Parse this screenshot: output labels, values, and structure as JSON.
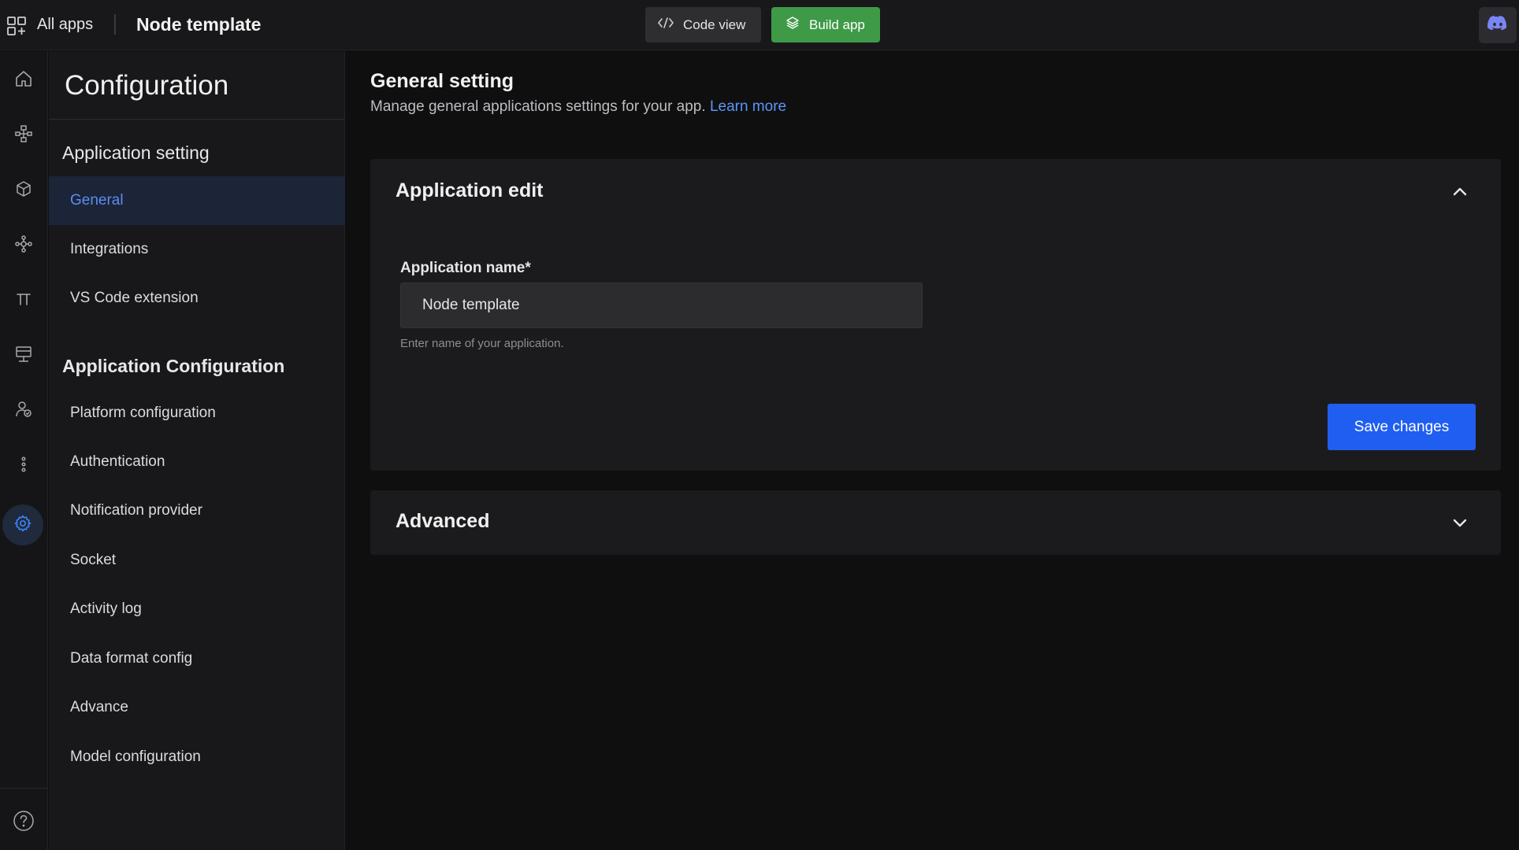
{
  "topbar": {
    "all_apps_label": "All apps",
    "app_title": "Node template",
    "code_view_label": "Code view",
    "build_app_label": "Build app",
    "build_color": "#3f9a47"
  },
  "rail": {
    "icons": [
      "home-icon",
      "workflow-icon",
      "models-icon",
      "graph-icon",
      "pi-icon",
      "deploy-icon",
      "users-icon",
      "more-vertical-icon",
      "settings-icon",
      "help-icon"
    ],
    "active": "settings-icon",
    "accent": "#3b82f6"
  },
  "config": {
    "title": "Configuration",
    "group1_title": "Application setting",
    "group1_items": [
      "General",
      "Integrations",
      "VS Code extension"
    ],
    "group2_title": "Application Configuration",
    "group2_items": [
      "Platform configuration",
      "Authentication",
      "Notification provider",
      "Socket",
      "Activity log",
      "Data format config",
      "Advance",
      "Model configuration"
    ],
    "active_item": "General"
  },
  "main": {
    "title": "General setting",
    "subtitle": "Manage general applications settings for your app.",
    "learn_more": "Learn more",
    "edit_card": {
      "title": "Application edit",
      "field_label": "Application name*",
      "field_value": "Node template",
      "field_help": "Enter name of your application.",
      "save_label": "Save changes"
    },
    "advanced_card": {
      "title": "Advanced"
    }
  }
}
